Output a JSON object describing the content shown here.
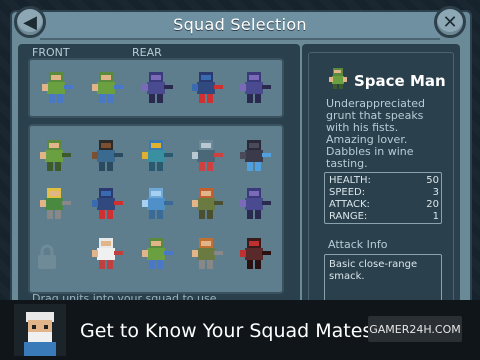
{
  "header": {
    "title": "Squad Selection"
  },
  "buttons": {
    "back_icon": "back-arrow-icon",
    "close_icon": "close-x-icon"
  },
  "squad": {
    "front_label": "FRONT",
    "rear_label": "REAR",
    "slots": [
      "grunt-blue-shield",
      "grunt-blue-shield",
      "purple-scout",
      "red-flag-bearer",
      "purple-scout"
    ]
  },
  "roster": {
    "units": [
      "space-man",
      "dark-brawler",
      "bird-gunner",
      "armored-gunner",
      "shadow-blade",
      "blonde-gunner",
      "red-flag-bearer",
      "blue-ice-brute",
      "orange-brawler",
      "purple-scout",
      "locked",
      "white-medic",
      "shield-grunt",
      "orange-rifleman",
      "masked-reaper"
    ],
    "hint": "Drag units into your squad to use."
  },
  "detail": {
    "name": "Space Man",
    "description": "Underappreciated grunt that speaks with his fists. Amazing lover. Dabbles in wine tasting.",
    "stats": [
      {
        "label": "HEALTH:",
        "value": "50"
      },
      {
        "label": "SPEED:",
        "value": "3"
      },
      {
        "label": "ATTACK:",
        "value": "20"
      },
      {
        "label": "RANGE:",
        "value": "1"
      }
    ],
    "attack_title": "Attack Info",
    "attack_desc": "Basic close-range smack."
  },
  "banner": {
    "text": "Get to Know Your Squad Mates!",
    "watermark": "GAMER24H.COM"
  },
  "colors": {
    "panel": "#2a404d",
    "frame": "#6b8a98",
    "text": "#ffffff"
  }
}
